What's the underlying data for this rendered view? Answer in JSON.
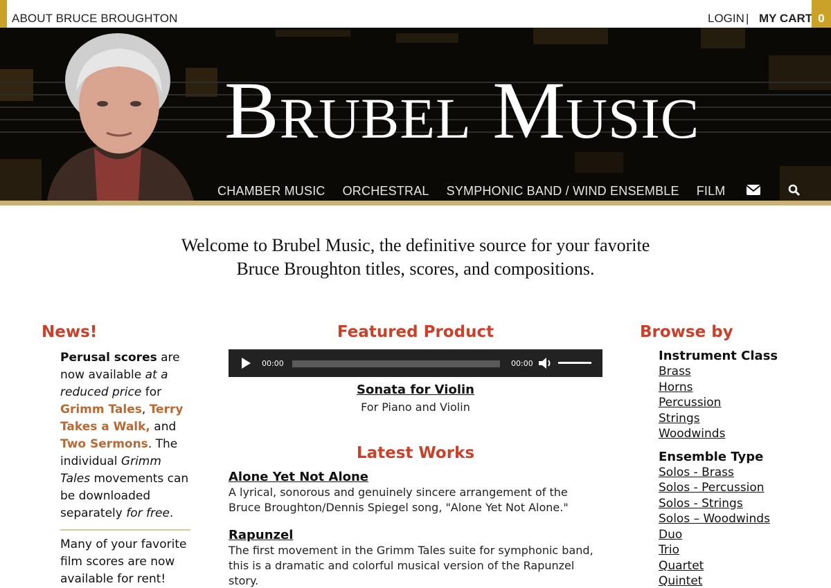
{
  "topbar": {
    "about": "ABOUT BRUCE BROUGHTON",
    "login": "LOGIN",
    "separator": "|",
    "cart": "MY CART",
    "cart_count": "0"
  },
  "banner": {
    "brand": "Brubel Music",
    "nav": [
      "CHAMBER MUSIC",
      "ORCHESTRAL",
      "SYMPHONIC BAND / WIND ENSEMBLE",
      "FILM"
    ],
    "icons": [
      "envelope-icon",
      "search-icon"
    ]
  },
  "welcome": {
    "line1": "Welcome to Brubel Music, the definitive source for your favorite",
    "line2": "Bruce Broughton titles, scores, and compositions."
  },
  "news": {
    "heading": "News!",
    "p1_bold": "Perusal scores",
    "p1_a": " are now available ",
    "p1_em": "at a reduced price",
    "p1_b": " for ",
    "link1": "Grimm Tales",
    "comma": ", ",
    "link2": "Terry Takes a Walk,",
    "and": " and ",
    "link3": "Two Sermons",
    "p1_c": ". The individual ",
    "p1_em2": "Grimm Tales",
    "p1_d": " movements can be downloaded separately ",
    "p1_em3": "for free",
    "p1_e": ".",
    "p2": "Many of your favorite film scores are now available for rent!"
  },
  "featured": {
    "heading": "Featured Product",
    "time_current": "00:00",
    "time_total": "00:00",
    "title": "Sonata for Violin",
    "subtitle": "For Piano and Violin"
  },
  "latest": {
    "heading": "Latest Works",
    "items": [
      {
        "title": "Alone Yet Not Alone",
        "desc": "A lyrical, sonorous and genuinely sincere arrangement of the Bruce Broughton/Dennis Spiegel song, \"Alone Yet Not Alone.\""
      },
      {
        "title": "Rapunzel",
        "desc": "The first movement in the Grimm Tales suite for symphonic band, this is a dramatic and colorful musical version of the Rapunzel story."
      }
    ]
  },
  "browse": {
    "heading": "Browse by",
    "instrument_head": "Instrument Class",
    "instruments": [
      "Brass",
      "Horns",
      "Percussion",
      "Strings",
      "Woodwinds"
    ],
    "ensemble_head": "Ensemble Type",
    "ensembles": [
      "Solos - Brass",
      "Solos - Percussion",
      "Solos - Strings",
      "Solos – Woodwinds",
      "Duo",
      "Trio",
      "Quartet",
      "Quintet"
    ]
  },
  "colors": {
    "accent_gold": "#c9a227",
    "heading_red": "#c8412b",
    "link_orange": "#b96a33"
  }
}
